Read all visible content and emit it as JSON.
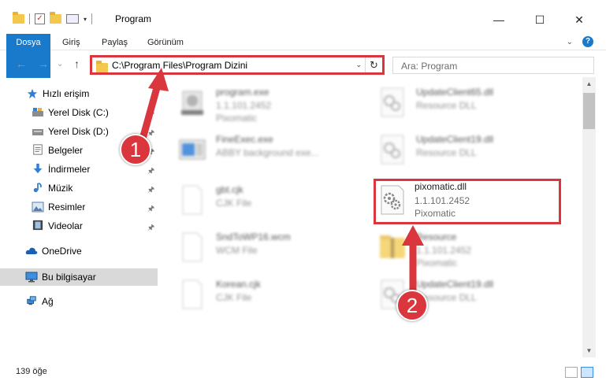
{
  "window": {
    "title": "Program",
    "controls": {
      "minimize": "—",
      "maximize": "☐",
      "close": "✕"
    },
    "qat_check": "✓",
    "qat_dropdown": "▾"
  },
  "ribbon": {
    "tabs": [
      "Dosya",
      "Giriş",
      "Paylaş",
      "Görünüm"
    ],
    "expand": "⌄",
    "help": "?"
  },
  "nav": {
    "back": "←",
    "forward": "→",
    "recent": "⌄",
    "up": "↑",
    "address": "C:\\Program Files\\Program Dizini",
    "address_dropdown": "⌄",
    "refresh": "↻",
    "search_placeholder": "Ara: Program"
  },
  "sidebar": {
    "items": [
      {
        "label": "Hızlı erişim",
        "icon": "star-icon"
      },
      {
        "label": "Yerel Disk (C:)",
        "icon": "drive-icon",
        "pinned": true
      },
      {
        "label": "Yerel Disk (D:)",
        "icon": "drive-icon",
        "pinned": true
      },
      {
        "label": "Belgeler",
        "icon": "documents-icon",
        "pinned": true
      },
      {
        "label": "İndirmeler",
        "icon": "download-icon",
        "pinned": true
      },
      {
        "label": "Müzik",
        "icon": "music-icon",
        "pinned": true
      },
      {
        "label": "Resimler",
        "icon": "pictures-icon",
        "pinned": true
      },
      {
        "label": "Videolar",
        "icon": "video-icon",
        "pinned": true
      },
      {
        "label": "OneDrive",
        "icon": "cloud-icon"
      },
      {
        "label": "Bu bilgisayar",
        "icon": "computer-icon",
        "selected": true
      },
      {
        "label": "Ağ",
        "icon": "network-icon"
      }
    ],
    "pin_glyph": "📌"
  },
  "files": [
    {
      "name": "program.exe",
      "line2": "1.1.101.2452",
      "line3": "Pixomatic",
      "icon": "exe-icon"
    },
    {
      "name": "UpdateClient65.dll",
      "line2": "Resource DLL",
      "line3": "",
      "icon": "dll-icon"
    },
    {
      "name": "FineExec.exe",
      "line2": "ABBY background exe...",
      "line3": "",
      "icon": "exe-window-icon"
    },
    {
      "name": "UpdateClient19.dll",
      "line2": "Resource DLL",
      "line3": "",
      "icon": "dll-icon"
    },
    {
      "name": "gbt.cjk",
      "line2": "CJK File",
      "line3": "",
      "icon": "file-icon"
    },
    {
      "name": "pixomatic.dll",
      "line2": "1.1.101.2452",
      "line3": "Pixomatic",
      "icon": "dll-gear-icon",
      "highlighted": true
    },
    {
      "name": "SndToWP16.wcm",
      "line2": "WCM File",
      "line3": "",
      "icon": "file-icon"
    },
    {
      "name": "Resource",
      "line2": "1.1.101.2452",
      "line3": "Pixomatic",
      "icon": "folder-zip-icon"
    },
    {
      "name": "Korean.cjk",
      "line2": "CJK File",
      "line3": "",
      "icon": "file-icon"
    },
    {
      "name": "UpdateClient19.dll",
      "line2": "Resource DLL",
      "line3": "",
      "icon": "dll-icon"
    }
  ],
  "status": {
    "item_count": "139 öğe"
  },
  "annotations": {
    "badge_1": "1",
    "badge_2": "2",
    "color": "#d9363e"
  },
  "colors": {
    "accent": "#1979ca",
    "highlight": "#d9363e",
    "selected": "#d9d9d9"
  }
}
